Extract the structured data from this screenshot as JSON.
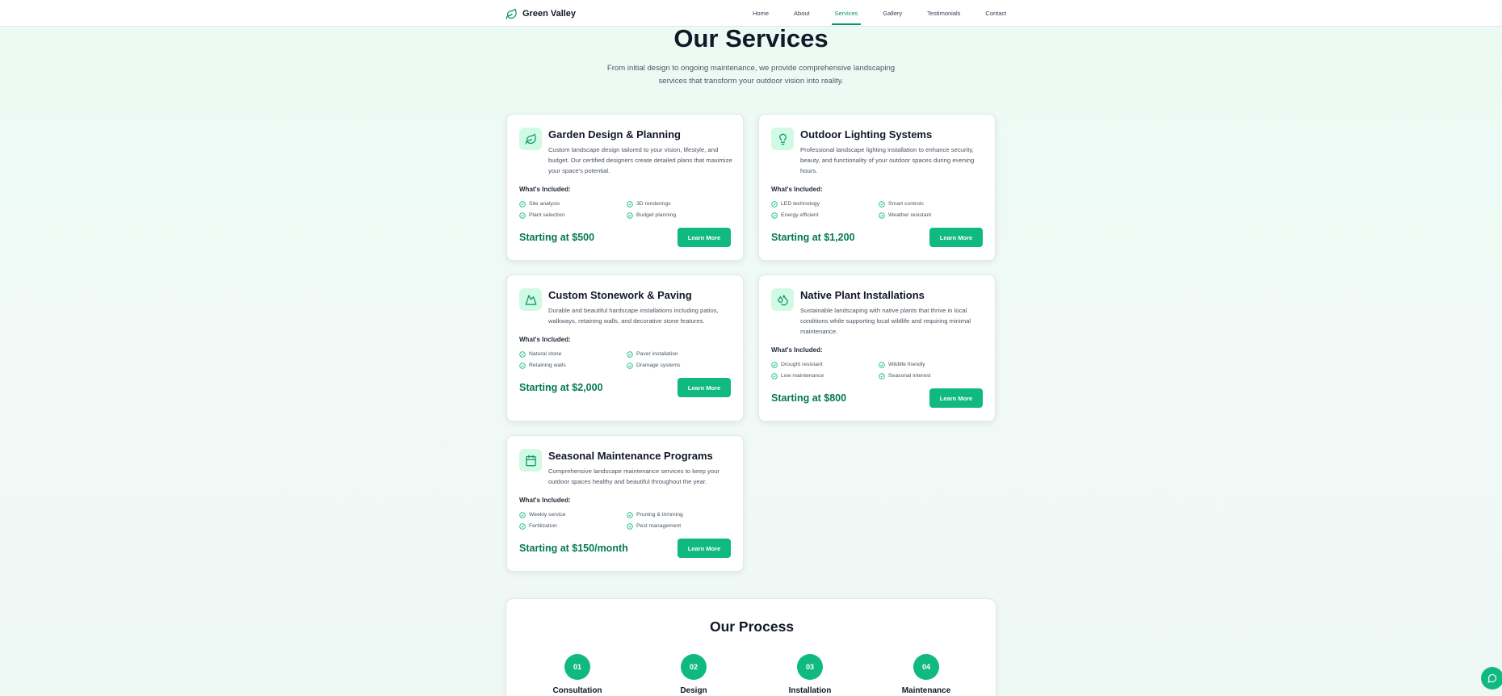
{
  "nav": {
    "brand": "Green Valley",
    "links": [
      "Home",
      "About",
      "Services",
      "Gallery",
      "Testimonials",
      "Contact"
    ],
    "active": "Services"
  },
  "header": {
    "title": "Our Services",
    "subtitle": "From initial design to ongoing maintenance, we provide comprehensive landscaping services that transform your outdoor vision into reality."
  },
  "included_label": "What's Included:",
  "learn_more_label": "Learn More",
  "services": [
    {
      "icon": "leaf-icon",
      "title": "Garden Design & Planning",
      "description": "Custom landscape design tailored to your vision, lifestyle, and budget. Our certified designers create detailed plans that maximize your space's potential.",
      "features": [
        "Site analysis",
        "3D renderings",
        "Plant selection",
        "Budget planning"
      ],
      "price": "Starting at $500"
    },
    {
      "icon": "lightbulb-icon",
      "title": "Outdoor Lighting Systems",
      "description": "Professional landscape lighting installation to enhance security, beauty, and functionality of your outdoor spaces during evening hours.",
      "features": [
        "LED technology",
        "Smart controls",
        "Energy efficient",
        "Weather resistant"
      ],
      "price": "Starting at $1,200"
    },
    {
      "icon": "mountain-icon",
      "title": "Custom Stonework & Paving",
      "description": "Durable and beautiful hardscape installations including patios, walkways, retaining walls, and decorative stone features.",
      "features": [
        "Natural stone",
        "Paver installation",
        "Retaining walls",
        "Drainage systems"
      ],
      "price": "Starting at $2,000"
    },
    {
      "icon": "droplets-icon",
      "title": "Native Plant Installations",
      "description": "Sustainable landscaping with native plants that thrive in local conditions while supporting local wildlife and requiring minimal maintenance.",
      "features": [
        "Drought resistant",
        "Wildlife friendly",
        "Low maintenance",
        "Seasonal interest"
      ],
      "price": "Starting at $800"
    },
    {
      "icon": "calendar-icon",
      "title": "Seasonal Maintenance Programs",
      "description": "Comprehensive landscape maintenance services to keep your outdoor spaces healthy and beautiful throughout the year.",
      "features": [
        "Weekly service",
        "Pruning & trimming",
        "Fertilization",
        "Pest management"
      ],
      "price": "Starting at $150/month"
    }
  ],
  "process": {
    "title": "Our Process",
    "steps": [
      {
        "num": "01",
        "name": "Consultation"
      },
      {
        "num": "02",
        "name": "Design"
      },
      {
        "num": "03",
        "name": "Installation"
      },
      {
        "num": "04",
        "name": "Maintenance"
      }
    ]
  },
  "colors": {
    "accent": "#10b981",
    "accent_dark": "#047857",
    "icon_bg": "#d1fae5"
  },
  "chat": {
    "icon": "message-circle-icon"
  }
}
